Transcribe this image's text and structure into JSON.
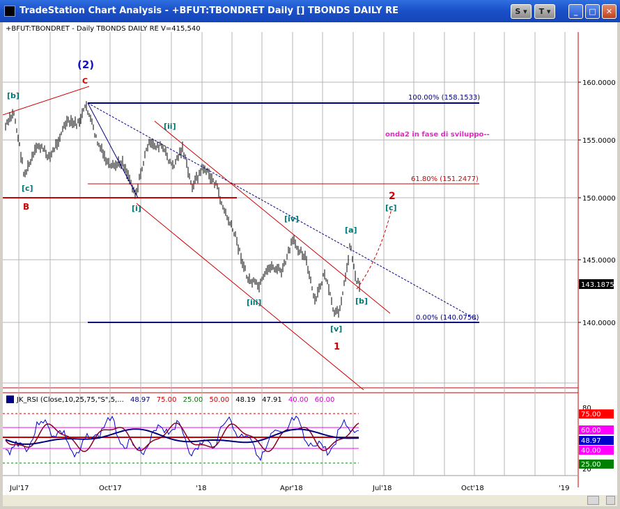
{
  "window": {
    "title": "TradeStation Chart Analysis - +BFUT:TBONDRET Daily [] TBONDS DAILY RE",
    "btn_s": "S",
    "btn_t": "T"
  },
  "chart": {
    "header": "+BFUT:TBONDRET - Daily  TBONDS DAILY RE  V=415,540",
    "last_price": "143.1875",
    "price_ticks": [
      "160.0000",
      "155.0000",
      "150.0000",
      "145.0000",
      "140.0000"
    ],
    "date_ticks": [
      "Jul'17",
      "Oct'17",
      "'18",
      "Apr'18",
      "Jul'18",
      "Oct'18",
      "'19"
    ],
    "fib_levels": [
      {
        "label": "100.00% (158.1533)",
        "price": 158.1533
      },
      {
        "label": "61.80% (151.2477)",
        "price": 151.2477
      },
      {
        "label": "0.00% (140.0758)",
        "price": 140.0758
      }
    ],
    "annotation": "onda2 in fase di sviluppo--",
    "wave_labels": {
      "w2": "(2)",
      "C": "C",
      "b_top": "[b]",
      "c_left": "[c]",
      "B": "B",
      "i": "[i]",
      "ii": "[ii]",
      "iii": "[iii]",
      "iv": "[iv]",
      "v": "[v]",
      "one": "1",
      "a": "[a]",
      "b": "[b]",
      "two": "2",
      "c_right": "[c]"
    }
  },
  "indicator": {
    "header": "JK_RSI (Close,10,25,75,\"S\",5,...",
    "values": [
      {
        "text": "48.97",
        "color": "#000080"
      },
      {
        "text": "75.00",
        "color": "#cc0000"
      },
      {
        "text": "25.00",
        "color": "#007700"
      },
      {
        "text": "50.00",
        "color": "#cc0000"
      },
      {
        "text": "48.19",
        "color": "#000000"
      },
      {
        "text": "47.91",
        "color": "#000000"
      },
      {
        "text": "40.00",
        "color": "#cc00cc"
      },
      {
        "text": "60.00",
        "color": "#cc00cc"
      }
    ],
    "axis_ticks": [
      "80",
      "20"
    ],
    "tags": [
      {
        "text": "75.00",
        "bg": "#ff0000"
      },
      {
        "text": "60.00",
        "bg": "#ff00ff"
      },
      {
        "text": "48.97",
        "bg": "#0000cc"
      },
      {
        "text": "40.00",
        "bg": "#ff00ff"
      },
      {
        "text": "25.00",
        "bg": "#008000"
      }
    ]
  }
}
